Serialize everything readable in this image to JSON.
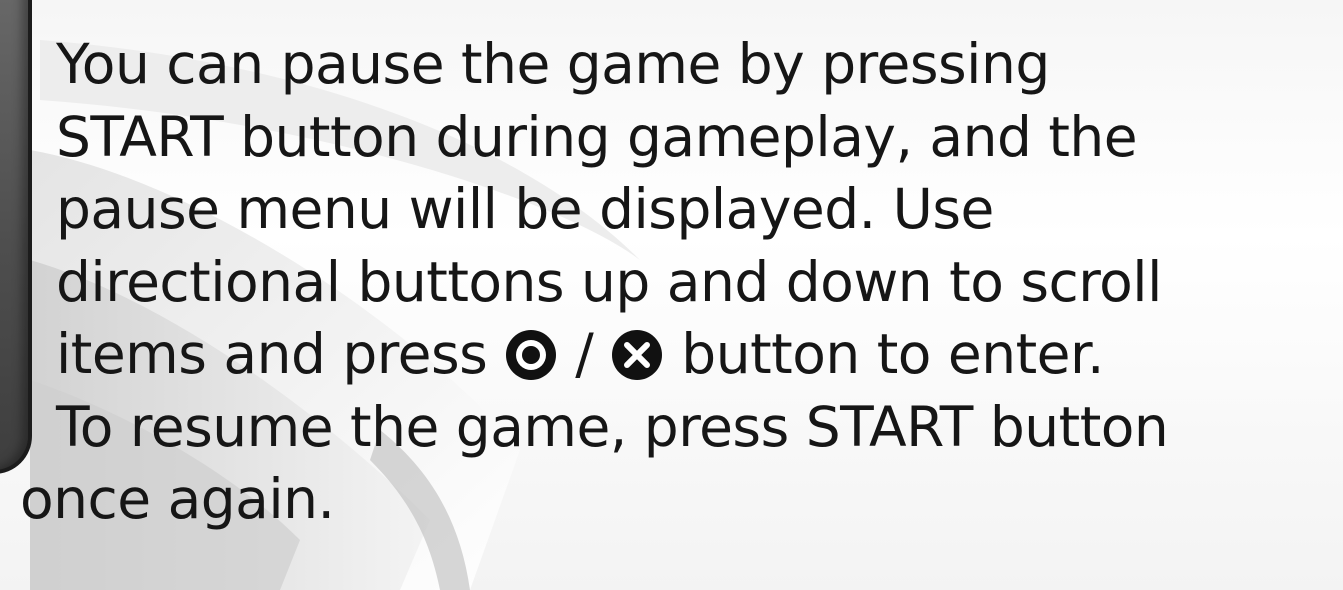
{
  "instructions": {
    "lines": [
      "You can pause the game by pressing",
      "START button during gameplay, and the",
      "pause menu will be displayed. Use",
      "directional buttons up and down to scroll",
      "items and press",
      "To resume the game, press START button",
      "once again."
    ],
    "separator": "/",
    "after_icons": "button to enter."
  },
  "icons": {
    "confirm": "circle-button-icon",
    "alternate": "cross-button-icon"
  },
  "colors": {
    "text": "#161616",
    "icon": "#111111",
    "panel": "#4e4e4e"
  }
}
